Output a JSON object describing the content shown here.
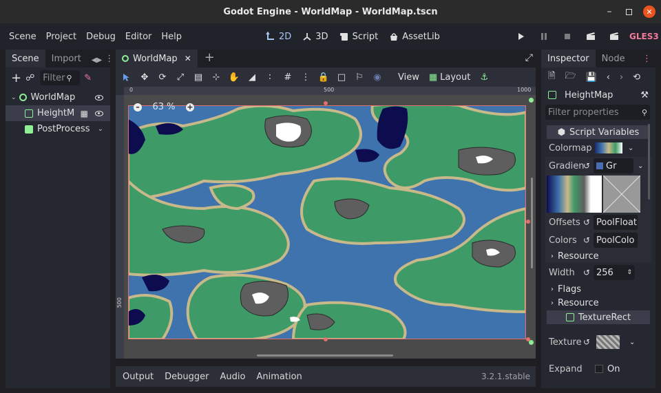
{
  "window": {
    "title": "Godot Engine - WorldMap - WorldMap.tscn"
  },
  "menu": [
    "Scene",
    "Project",
    "Debug",
    "Editor",
    "Help"
  ],
  "modes": [
    {
      "label": "2D",
      "icon": "2d-icon",
      "active": true
    },
    {
      "label": "3D",
      "icon": "3d-icon",
      "active": false
    },
    {
      "label": "Script",
      "icon": "script-icon",
      "active": false
    },
    {
      "label": "AssetLib",
      "icon": "assetlib-icon",
      "active": false
    }
  ],
  "renderer": "GLES3",
  "scene_panel": {
    "tabs": [
      "Scene",
      "Import"
    ],
    "filter_placeholder": "Filter",
    "tree": [
      {
        "label": "WorldMap",
        "icon": "node2d-icon"
      },
      {
        "label": "HeightM",
        "icon": "texture-rect-icon"
      },
      {
        "label": "PostProcess",
        "icon": "color-rect-icon"
      }
    ]
  },
  "editor": {
    "scene_tab": "WorldMap",
    "zoom": "63 %",
    "view_label": "View",
    "layout_label": "Layout",
    "ruler": {
      "h": [
        "0",
        "500",
        "1000"
      ],
      "v": [
        "500"
      ]
    }
  },
  "bottom_panel": {
    "tabs": [
      "Output",
      "Debugger",
      "Audio",
      "Animation"
    ],
    "version": "3.2.1.stable"
  },
  "inspector": {
    "tabs": [
      "Inspector",
      "Node"
    ],
    "node_name": "HeightMap",
    "filter_placeholder": "Filter properties",
    "section_script": "Script Variables",
    "colormap_label": "Colormap",
    "gradient_label": "Gradien",
    "gradient_value": "Gr",
    "offsets_label": "Offsets",
    "offsets_value": "PoolFloat",
    "colors_label": "Colors",
    "colors_value": "PoolColo",
    "resource_label": "Resource",
    "width_label": "Width",
    "width_value": "256",
    "flags_label": "Flags",
    "resource2_label": "Resource",
    "section_texture_rect": "TextureRect",
    "texture_label": "Texture",
    "expand_label": "Expand",
    "expand_value": "On"
  },
  "colors": {
    "accent": "#699ce8",
    "ocean": "#3f73ad",
    "deep": "#0d0c4f",
    "land": "#3e9a66",
    "sand": "#c8b98a",
    "rock": "#5e5e5e",
    "snow": "#ffffff"
  }
}
